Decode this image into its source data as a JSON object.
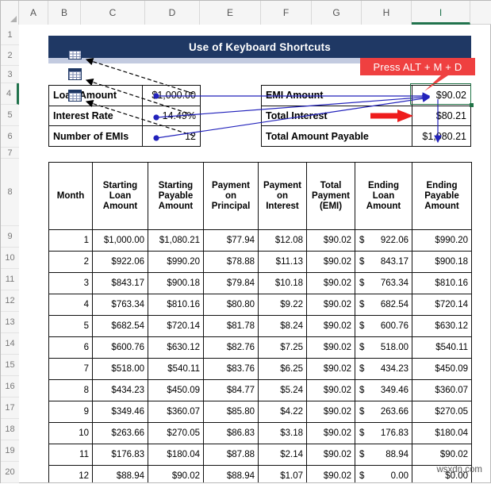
{
  "app": {
    "type": "spreadsheet",
    "watermark": "wsxdn.com"
  },
  "grid": {
    "column_headers": [
      "A",
      "B",
      "C",
      "D",
      "E",
      "F",
      "G",
      "H",
      "I"
    ],
    "active_column": "I",
    "active_row": "4",
    "row_headers": [
      "1",
      "2",
      "3",
      "4",
      "5",
      "6",
      "7",
      "8",
      "9",
      "10",
      "11",
      "12",
      "13",
      "14",
      "15",
      "16",
      "17",
      "18",
      "19",
      "20"
    ]
  },
  "banner": {
    "title": "Use of Keyboard Shortcuts",
    "color": "#1F3864",
    "underline_color": "#C3CBE0"
  },
  "callout": {
    "text": "Press ALT + M + D",
    "color": "#EF4040"
  },
  "inputs_left": {
    "rows": [
      {
        "label": "Loan Amount",
        "value": "$1,000.00"
      },
      {
        "label": "Interest Rate",
        "value": "14.49%"
      },
      {
        "label": "Number of EMIs",
        "value": "12"
      }
    ]
  },
  "inputs_right": {
    "rows": [
      {
        "label": "EMI Amount",
        "value": "$90.02"
      },
      {
        "label": "Total Interest",
        "value": "$80.21"
      },
      {
        "label": "Total Amount Payable",
        "value": "$1,080.21"
      }
    ]
  },
  "amortization": {
    "headers": [
      "Month",
      "Starting Loan Amount",
      "Starting Payable Amount",
      "Payment on Principal",
      "Payment on Interest",
      "Total Payment (EMI)",
      "Ending Loan Amount",
      "Ending Payable Amount"
    ],
    "headers_wrapped": [
      [
        "Month"
      ],
      [
        "Starting",
        "Loan",
        "Amount"
      ],
      [
        "Starting",
        "Payable",
        "Amount"
      ],
      [
        "Payment",
        "on",
        "Principal"
      ],
      [
        "Payment",
        "on",
        "Interest"
      ],
      [
        "Total",
        "Payment",
        "(EMI)"
      ],
      [
        "Ending",
        "Loan",
        "Amount"
      ],
      [
        "Ending",
        "Payable",
        "Amount"
      ]
    ],
    "rows": [
      [
        "1",
        "$1,000.00",
        "$1,080.21",
        "$77.94",
        "$12.08",
        "$90.02",
        "$ 922.06",
        "$990.20"
      ],
      [
        "2",
        "$922.06",
        "$990.20",
        "$78.88",
        "$11.13",
        "$90.02",
        "$ 843.17",
        "$900.18"
      ],
      [
        "3",
        "$843.17",
        "$900.18",
        "$79.84",
        "$10.18",
        "$90.02",
        "$ 763.34",
        "$810.16"
      ],
      [
        "4",
        "$763.34",
        "$810.16",
        "$80.80",
        "$9.22",
        "$90.02",
        "$ 682.54",
        "$720.14"
      ],
      [
        "5",
        "$682.54",
        "$720.14",
        "$81.78",
        "$8.24",
        "$90.02",
        "$ 600.76",
        "$630.12"
      ],
      [
        "6",
        "$600.76",
        "$630.12",
        "$82.76",
        "$7.25",
        "$90.02",
        "$ 518.00",
        "$540.11"
      ],
      [
        "7",
        "$518.00",
        "$540.11",
        "$83.76",
        "$6.25",
        "$90.02",
        "$ 434.23",
        "$450.09"
      ],
      [
        "8",
        "$434.23",
        "$450.09",
        "$84.77",
        "$5.24",
        "$90.02",
        "$ 349.46",
        "$360.07"
      ],
      [
        "9",
        "$349.46",
        "$360.07",
        "$85.80",
        "$4.22",
        "$90.02",
        "$ 263.66",
        "$270.05"
      ],
      [
        "10",
        "$263.66",
        "$270.05",
        "$86.83",
        "$3.18",
        "$90.02",
        "$ 176.83",
        "$180.04"
      ],
      [
        "11",
        "$176.83",
        "$180.04",
        "$87.88",
        "$2.14",
        "$90.02",
        "$  88.94",
        "$90.02"
      ],
      [
        "12",
        "$88.94",
        "$90.02",
        "$88.94",
        "$1.07",
        "$90.02",
        "$   0.00",
        "$0.00"
      ]
    ]
  },
  "annotations": {
    "external_refs_count": 3,
    "trace_precedent_color": "#2222BB",
    "trace_external_color": "#000000",
    "red_arrow_color": "#EE1C1C",
    "selection_color": "#217346"
  }
}
